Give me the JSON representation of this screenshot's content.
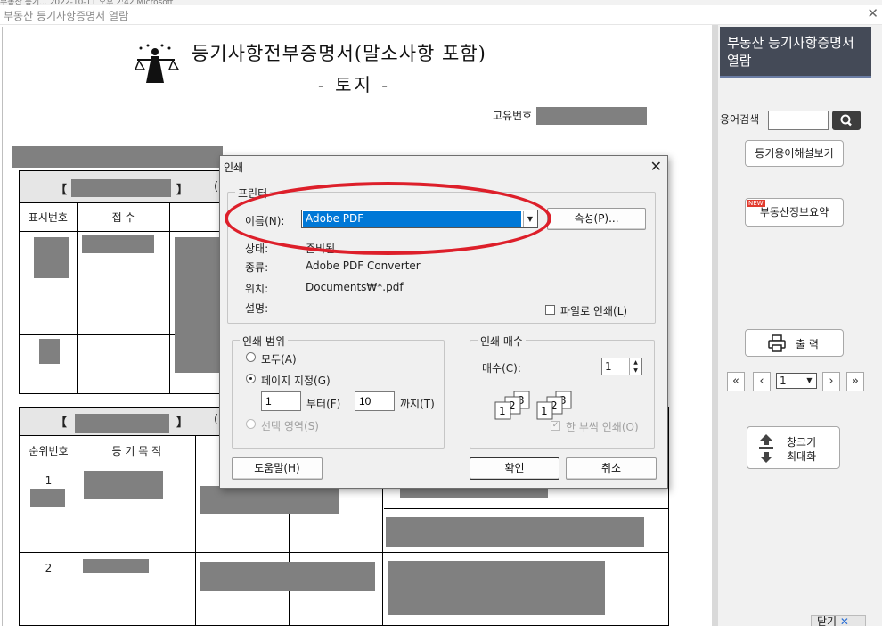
{
  "window": {
    "top_strip": "부동산 등기... 2022-10-11 오후 2:42   Microsoft",
    "title": "부동산 등기사항증명서 열람"
  },
  "document": {
    "title": "등기사항전부증명서(말소사항 포함)",
    "subtitle": "- 토지 -",
    "unique_number_label": "고유번호",
    "section1": {
      "bracket_open": "【",
      "bracket_close": "】",
      "paren": "(",
      "headers": [
        "표시번호",
        "접 수"
      ]
    },
    "section2": {
      "bracket_open": "【",
      "bracket_close": "】",
      "paren": "(",
      "headers": [
        "순위번호",
        "등 기 목 적"
      ],
      "rows": [
        "1",
        "2"
      ]
    }
  },
  "sidebar": {
    "header": "부동산 등기사항증명서 열람",
    "search_label": "용어검색",
    "search_value": "",
    "glossary_button": "등기용어해설보기",
    "new_badge": "NEW",
    "summary_button": "부동산정보요약",
    "print_button": "출 력",
    "nav": {
      "first": "«",
      "prev": "‹",
      "page": "1",
      "next": "›",
      "last": "»"
    },
    "maximize_line1": "창크기",
    "maximize_line2": "최대화",
    "close_tab": "닫기"
  },
  "print_dialog": {
    "title": "인쇄",
    "printer_group": "프린터",
    "name_label": "이름(N):",
    "printer_name": "Adobe PDF",
    "properties_button": "속성(P)...",
    "status_label": "상태:",
    "status_value": "준비됨",
    "type_label": "종류:",
    "type_value": "Adobe PDF Converter",
    "location_label": "위치:",
    "location_value": "Documents₩*.pdf",
    "comment_label": "설명:",
    "print_to_file": "파일로 인쇄(L)",
    "range_group": "인쇄 범위",
    "range_all": "모두(A)",
    "range_pages": "페이지 지정(G)",
    "from_value": "1",
    "from_label": "부터(F)",
    "to_value": "10",
    "to_label": "까지(T)",
    "range_selection": "선택 영역(S)",
    "copies_group": "인쇄 매수",
    "copies_label": "매수(C):",
    "copies_value": "1",
    "collate_label": "한 부씩 인쇄(O)",
    "help_button": "도움말(H)",
    "ok_button": "확인",
    "cancel_button": "취소"
  },
  "colors": {
    "sidebar_header": "#444a57",
    "highlight": "#0078d7",
    "annotation_oval": "#dd1f2a",
    "redaction": "#808080"
  }
}
